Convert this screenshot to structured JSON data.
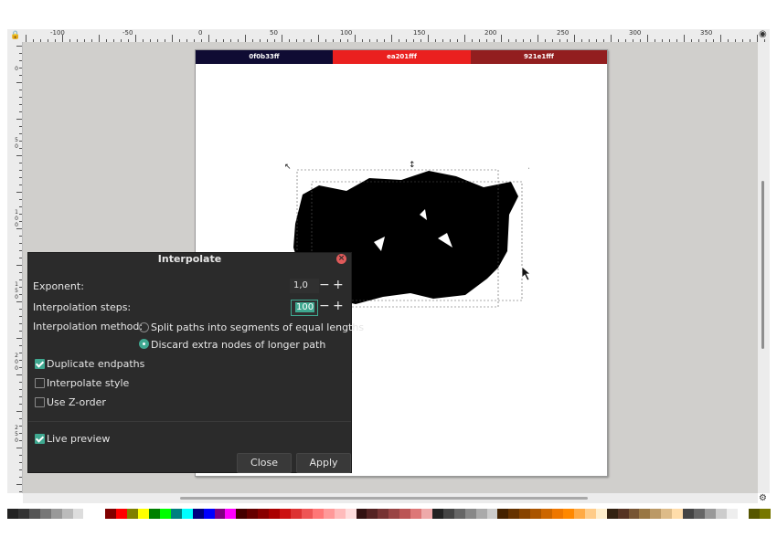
{
  "ruler": {
    "labels": [
      "-100",
      "-50",
      "0",
      "50",
      "100",
      "150",
      "200",
      "250",
      "300",
      "350"
    ],
    "vlabels": [
      [
        "0"
      ],
      [
        "5",
        "0"
      ],
      [
        "1",
        "0",
        "0"
      ],
      [
        "1",
        "5",
        "0"
      ],
      [
        "2",
        "0",
        "0"
      ],
      [
        "2",
        "5",
        "0"
      ]
    ]
  },
  "swatches": [
    {
      "label": "0f0b33ff",
      "color": "#0f0b33"
    },
    {
      "label": "ea201fff",
      "color": "#ea201f"
    },
    {
      "label": "921e1fff",
      "color": "#921e1f"
    }
  ],
  "dialog": {
    "title": "Interpolate",
    "exponent_label": "Exponent:",
    "exponent_value": "1,0",
    "steps_label": "Interpolation steps:",
    "steps_value": "100",
    "method_label": "Interpolation method:",
    "method_option1": "Split paths into segments of equal lengths",
    "method_option2": "Discard extra nodes of longer path",
    "duplicate_endpaths": "Duplicate endpaths",
    "interpolate_style": "Interpolate style",
    "use_zorder": "Use Z-order",
    "live_preview": "Live preview",
    "close_button": "Close",
    "apply_button": "Apply",
    "minus": "−",
    "plus": "+"
  },
  "palette": [
    "#222222",
    "#333333",
    "#555555",
    "#777777",
    "#999999",
    "#bbbbbb",
    "#dddddd",
    "#ffffff",
    "#ffffff",
    "#800000",
    "#ff0000",
    "#808000",
    "#ffff00",
    "#008000",
    "#00ff00",
    "#008080",
    "#00ffff",
    "#000080",
    "#0000ff",
    "#800080",
    "#ff00ff",
    "#440000",
    "#660000",
    "#880000",
    "#aa0000",
    "#cc1111",
    "#dd3333",
    "#ee5555",
    "#ff7777",
    "#ff9999",
    "#ffbbbb",
    "#ffdddd",
    "#331111",
    "#552222",
    "#773333",
    "#994444",
    "#bb5555",
    "#dd7777",
    "#eeaaaa",
    "#222222",
    "#444444",
    "#666666",
    "#888888",
    "#aaaaaa",
    "#cccccc",
    "#442200",
    "#663300",
    "#884400",
    "#aa5500",
    "#cc6600",
    "#ee7700",
    "#ff8800",
    "#ffaa44",
    "#ffcc88",
    "#ffeecc",
    "#332211",
    "#553322",
    "#775533",
    "#997744",
    "#bb9966",
    "#ddbb88",
    "#ffddaa",
    "#444444",
    "#666666",
    "#999999",
    "#cccccc",
    "#eeeeee",
    "#ffffff",
    "#555500",
    "#777700"
  ]
}
